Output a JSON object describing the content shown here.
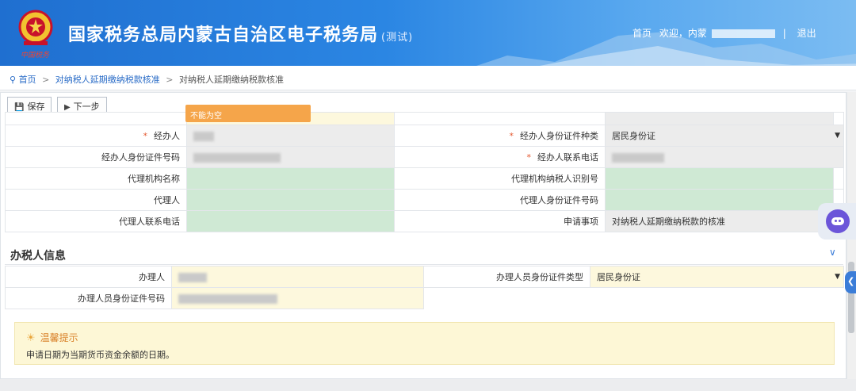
{
  "header": {
    "title": "国家税务总局内蒙古自治区电子税务局",
    "title_tag": "(测试)",
    "slogan": "中国税务",
    "nav": {
      "home": "首页",
      "welcome": "欢迎，内蒙",
      "logout": "退出",
      "separator": "|"
    }
  },
  "breadcrumb": {
    "home": "首页",
    "level1": "对纳税人延期缴纳税款核准",
    "level2": "对纳税人延期缴纳税款核准",
    "sep": ">"
  },
  "toolbar": {
    "save_label": "保存",
    "next_label": "下一步"
  },
  "tooltip": {
    "text": "不能为空"
  },
  "form": {
    "required_mark": "*",
    "operator_label": "经办人",
    "operator_id_type_label": "经办人身份证件种类",
    "operator_id_type_value": "居民身份证",
    "operator_id_no_label": "经办人身份证件号码",
    "operator_phone_label": "经办人联系电话",
    "agency_name_label": "代理机构名称",
    "agency_taxid_label": "代理机构纳税人识别号",
    "agent_label": "代理人",
    "agent_id_no_label": "代理人身份证件号码",
    "agent_phone_label": "代理人联系电话",
    "apply_item_label": "申请事项",
    "apply_item_value": "对纳税人延期缴纳税款的核准"
  },
  "handler_section": {
    "title": "办税人信息",
    "handler_label": "办理人",
    "handler_id_type_label": "办理人员身份证件类型",
    "handler_id_type_value": "居民身份证",
    "handler_id_no_label": "办理人员身份证件号码"
  },
  "tip": {
    "title": "温馨提示",
    "body": "申请日期为当期货币资金余额的日期。"
  },
  "colors": {
    "accent": "#2a6cc7",
    "required": "#e4572e",
    "tooltip": "#f5a54a",
    "green_field": "#cfe9d4",
    "yellow_field": "#fdf8dd"
  }
}
